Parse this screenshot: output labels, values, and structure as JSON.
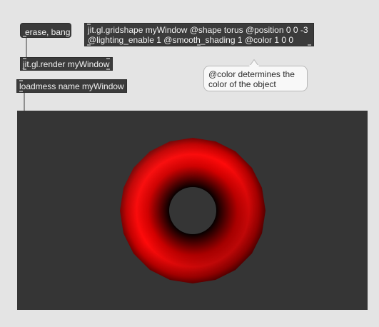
{
  "messages": {
    "erase_bang": "erase, bang"
  },
  "objects": {
    "render": "jit.gl.render myWindow",
    "loadmess": "loadmess name myWindow",
    "gridshape_line1": "jit.gl.gridshape myWindow @shape torus @position 0 0 -3",
    "gridshape_line2": "@lighting_enable 1 @smooth_shading 1 @color 1 0 0"
  },
  "comment": {
    "line1": "@color determines the",
    "line2": "color of the object"
  },
  "jit_window": {
    "background_color": "#353535",
    "shape": "torus",
    "shape_color": "#ff0000"
  }
}
